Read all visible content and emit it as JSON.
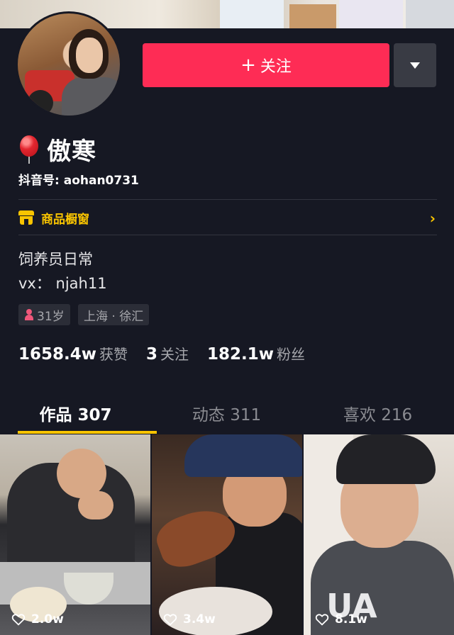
{
  "profile": {
    "nickname": "傲寒",
    "uid_label": "抖音号: aohan0731",
    "follow_label": "关注",
    "follow_plus": "+",
    "shop_label": "商品橱窗",
    "bio_line1": "饲养员日常",
    "bio_line2": "vx：  njah11",
    "age_tag": "31岁",
    "location_tag": "上海 · 徐汇"
  },
  "stats": [
    {
      "value": "1658.4w",
      "label": "获赞"
    },
    {
      "value": "3",
      "label": "关注"
    },
    {
      "value": "182.1w",
      "label": "粉丝"
    }
  ],
  "tabs": [
    {
      "label": "作品 307",
      "active": true
    },
    {
      "label": "动态 311",
      "active": false
    },
    {
      "label": "喜欢 216",
      "active": false
    }
  ],
  "videos": [
    {
      "likes": "2.0w"
    },
    {
      "likes": "3.4w"
    },
    {
      "likes": "8.1w"
    }
  ],
  "icons": {
    "balloon": "balloon-icon",
    "shop": "shop-icon",
    "chevron": "chevron-right-icon",
    "female": "female-icon",
    "heart": "heart-icon",
    "dropdown": "caret-down-icon"
  },
  "colors": {
    "background": "#161823",
    "accent": "#fe2c55",
    "shop": "#f9c400"
  },
  "shop_chevron": "›",
  "video3_overlay_text": "UA"
}
